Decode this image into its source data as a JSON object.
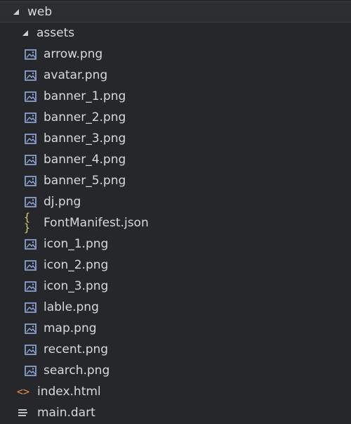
{
  "tree": {
    "root": {
      "label": "web",
      "arrow_icon": "chevron-down-icon"
    },
    "folder": {
      "label": "assets",
      "arrow_icon": "chevron-down-icon"
    },
    "asset_files": [
      {
        "label": "arrow.png",
        "icon": "image-icon"
      },
      {
        "label": "avatar.png",
        "icon": "image-icon"
      },
      {
        "label": "banner_1.png",
        "icon": "image-icon"
      },
      {
        "label": "banner_2.png",
        "icon": "image-icon"
      },
      {
        "label": "banner_3.png",
        "icon": "image-icon"
      },
      {
        "label": "banner_4.png",
        "icon": "image-icon"
      },
      {
        "label": "banner_5.png",
        "icon": "image-icon"
      },
      {
        "label": "dj.png",
        "icon": "image-icon"
      },
      {
        "label": "FontManifest.json",
        "icon": "json-icon"
      },
      {
        "label": "icon_1.png",
        "icon": "image-icon"
      },
      {
        "label": "icon_2.png",
        "icon": "image-icon"
      },
      {
        "label": "icon_3.png",
        "icon": "image-icon"
      },
      {
        "label": "lable.png",
        "icon": "image-icon"
      },
      {
        "label": "map.png",
        "icon": "image-icon"
      },
      {
        "label": "recent.png",
        "icon": "image-icon"
      },
      {
        "label": "search.png",
        "icon": "image-icon"
      }
    ],
    "web_files": [
      {
        "label": "index.html",
        "icon": "html-icon"
      },
      {
        "label": "main.dart",
        "icon": "dart-icon"
      }
    ],
    "icons": {
      "json": "{ }",
      "html": "<>"
    },
    "colors": {
      "background": "#25272a",
      "text": "#d7dadd",
      "image_icon": "#8ea7d8",
      "json_icon": "#d7d36f",
      "html_icon": "#ea8f45"
    }
  }
}
